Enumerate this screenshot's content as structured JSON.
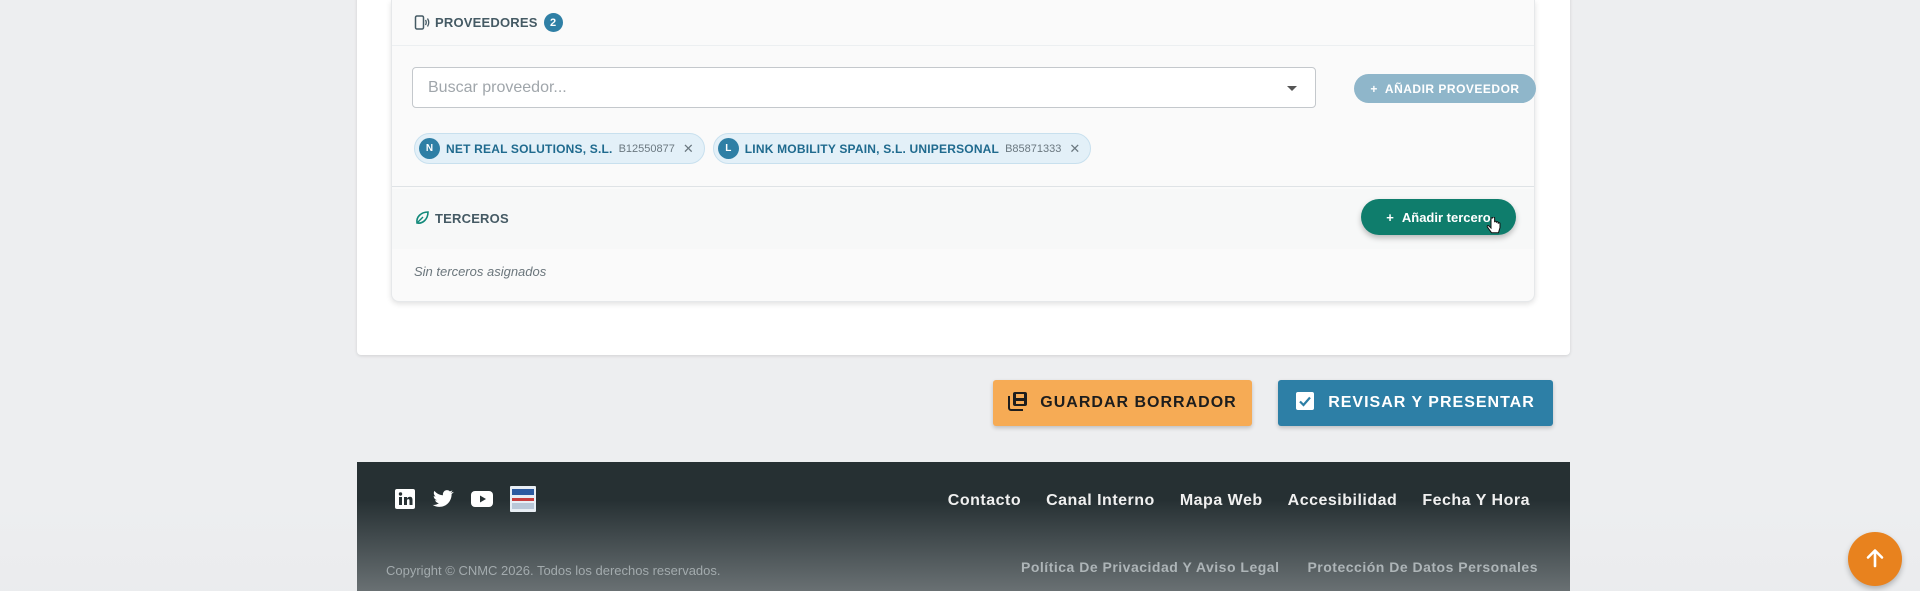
{
  "proveedores": {
    "title": "PROVEEDORES",
    "count": "2",
    "search_placeholder": "Buscar proveedor...",
    "add_button": "AÑADIR PROVEEDOR",
    "chips": [
      {
        "initial": "N",
        "name": "NET REAL SOLUTIONS, S.L.",
        "cif": "B12550877"
      },
      {
        "initial": "L",
        "name": "LINK MOBILITY SPAIN, S.L. UNIPERSONAL",
        "cif": "B85871333"
      }
    ]
  },
  "terceros": {
    "title": "TERCEROS",
    "add_button": "Añadir tercero",
    "empty_text": "Sin terceros asignados"
  },
  "actions": {
    "draft": "GUARDAR BORRADOR",
    "submit": "REVISAR Y PRESENTAR"
  },
  "footer": {
    "links": [
      "Contacto",
      "Canal Interno",
      "Mapa Web",
      "Accesibilidad",
      "Fecha Y Hora"
    ],
    "legal": [
      "Política De Privacidad Y Aviso Legal",
      "Protección De Datos Personales"
    ],
    "copyright": "Copyright © CNMC 2026. Todos los derechos reservados.",
    "social_icons": [
      "linkedin-icon",
      "twitter-icon",
      "youtube-icon",
      "sede-badge-icon"
    ]
  },
  "colors": {
    "primary": "#2d7fa6",
    "draft": "#f6ab55",
    "terceros_button": "#0f7d6c",
    "footer_bg": "#263033",
    "scroll_top": "#e8821e"
  }
}
